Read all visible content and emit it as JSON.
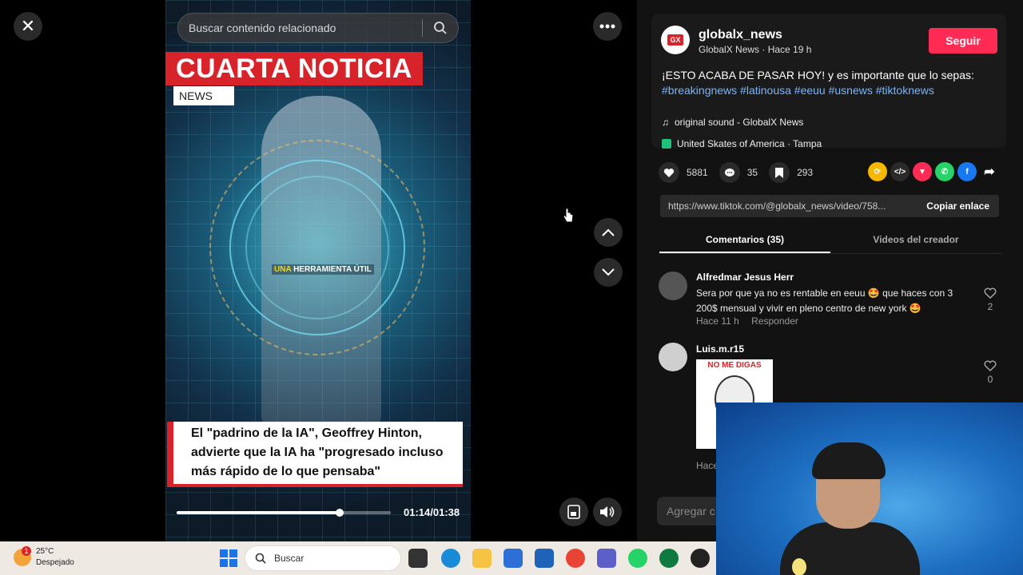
{
  "search": {
    "placeholder": "Buscar contenido relacionado"
  },
  "video": {
    "headline": "CUARTA NOTICIA",
    "tag": "NEWS",
    "overlay_word": "UNA",
    "overlay_rest": "HERRAMIENTA ÚTIL",
    "caption": "El \"padrino de la IA\", Geoffrey Hinton, advierte que la IA ha \"progresado incluso más rápido de lo que pensaba\"",
    "time": "01:14/01:38",
    "progress": 0.76
  },
  "post": {
    "username": "globalx_news",
    "subline": "GlobalX News · Hace 19 h",
    "follow_label": "Seguir",
    "desc_text": "¡ESTO ACABA DE PASAR HOY! y es importante que lo sepas:",
    "hashtags": "#breakingnews #latinousa #eeuu #usnews #tiktoknews",
    "sound": "original sound - GlobalX News",
    "location": "United Skates of America · Tampa",
    "likes": "5881",
    "comments": "35",
    "saves": "293",
    "url": "https://www.tiktok.com/@globalx_news/video/758...",
    "copy_label": "Copiar enlace"
  },
  "tabs": [
    "Comentarios (35)",
    "Videos del creador"
  ],
  "comments": [
    {
      "name": "Alfredmar Jesus Herr",
      "text": "Sera por que ya no es rentable en eeuu 🤩 que haces con 3 200$ mensual y vivir en pleno centro de new york 🤩",
      "time": "Hace 11 h",
      "reply": "Responder",
      "likes": "2"
    },
    {
      "name": "Luis.m.r15",
      "meme_text": "NO ME DIGAS",
      "time": "Hace",
      "likes": "0"
    }
  ],
  "comment_input": {
    "placeholder": "Agregar c"
  },
  "taskbar": {
    "temp": "25°C",
    "weather": "Despejado",
    "badge": "1",
    "search_label": "Buscar"
  },
  "colors": {
    "accent": "#fe2c55",
    "news_red": "#d9232a",
    "hashtag": "#77b6ff"
  }
}
